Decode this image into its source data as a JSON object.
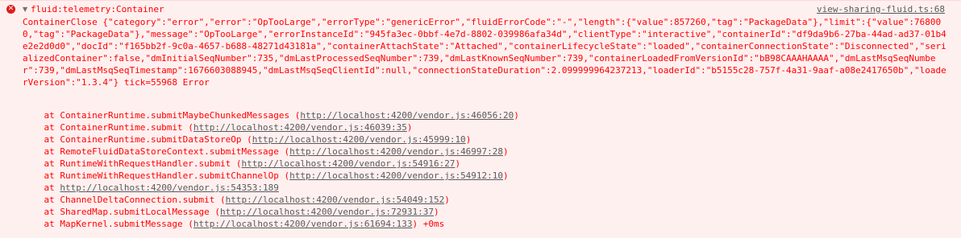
{
  "entry": {
    "level_icon": "error-circle-icon",
    "title": "fluid:telemetry:Container",
    "source_link": "view-sharing-fluid.ts:68",
    "message": "ContainerClose {\"category\":\"error\",\"error\":\"OpTooLarge\",\"errorType\":\"genericError\",\"fluidErrorCode\":\"-\",\"length\":{\"value\":857260,\"tag\":\"PackageData\"},\"limit\":{\"value\":768000,\"tag\":\"PackageData\"},\"message\":\"OpTooLarge\",\"errorInstanceId\":\"945fa3ec-0bbf-4e7d-8802-039986afa34d\",\"clientType\":\"interactive\",\"containerId\":\"df9da9b6-27ba-44ad-ad37-01b4e2e2d0d0\",\"docId\":\"f165bb2f-9c0a-4657-b688-48271d43181a\",\"containerAttachState\":\"Attached\",\"containerLifecycleState\":\"loaded\",\"containerConnectionState\":\"Disconnected\",\"serializedContainer\":false,\"dmInitialSeqNumber\":735,\"dmLastProcessedSeqNumber\":739,\"dmLastKnownSeqNumber\":739,\"containerLoadedFromVersionId\":\"bB98CAAAHAAAA\",\"dmLastMsqSeqNumber\":739,\"dmLastMsqSeqTimestamp\":1676603088945,\"dmLastMsqSeqClientId\":null,\"connectionStateDuration\":2.099999964237213,\"loaderId\":\"b5155c28-757f-4a31-9aaf-a08e2417650b\",\"loaderVersion\":\"1.3.4\"} tick=55968 Error",
    "stack": [
      {
        "prefix": "    at ContainerRuntime.submitMaybeChunkedMessages (",
        "url": "http://localhost:4200/vendor.js:46056:20",
        "suffix": ")"
      },
      {
        "prefix": "    at ContainerRuntime.submit (",
        "url": "http://localhost:4200/vendor.js:46039:35",
        "suffix": ")"
      },
      {
        "prefix": "    at ContainerRuntime.submitDataStoreOp (",
        "url": "http://localhost:4200/vendor.js:45999:10",
        "suffix": ")"
      },
      {
        "prefix": "    at RemoteFluidDataStoreContext.submitMessage (",
        "url": "http://localhost:4200/vendor.js:46997:28",
        "suffix": ")"
      },
      {
        "prefix": "    at RuntimeWithRequestHandler.submit (",
        "url": "http://localhost:4200/vendor.js:54916:27",
        "suffix": ")"
      },
      {
        "prefix": "    at RuntimeWithRequestHandler.submitChannelOp (",
        "url": "http://localhost:4200/vendor.js:54912:10",
        "suffix": ")"
      },
      {
        "prefix": "    at ",
        "url": "http://localhost:4200/vendor.js:54353:189",
        "suffix": ""
      },
      {
        "prefix": "    at ChannelDeltaConnection.submit (",
        "url": "http://localhost:4200/vendor.js:54049:152",
        "suffix": ")"
      },
      {
        "prefix": "    at SharedMap.submitLocalMessage (",
        "url": "http://localhost:4200/vendor.js:72931:37",
        "suffix": ")"
      },
      {
        "prefix": "    at MapKernel.submitMessage (",
        "url": "http://localhost:4200/vendor.js:61694:133",
        "suffix": ") +0ms"
      }
    ]
  }
}
